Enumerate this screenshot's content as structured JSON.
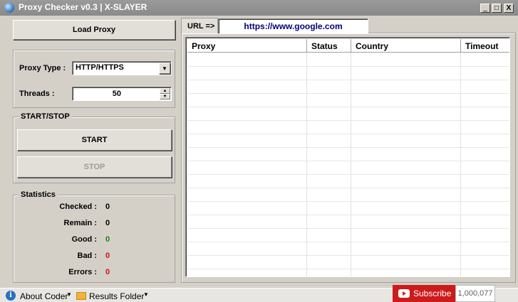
{
  "window": {
    "title": "Proxy Checker v0.3 | X-SLAYER",
    "controls": [
      "_",
      "□",
      "X"
    ]
  },
  "actions": {
    "load_proxy": "Load Proxy"
  },
  "settings": {
    "proxy_type_label": "Proxy Type :",
    "proxy_type_value": "HTTP/HTTPS",
    "threads_label": "Threads :",
    "threads_value": "50"
  },
  "control_group": {
    "title": "START/STOP",
    "start": "START",
    "stop": "STOP"
  },
  "statistics": {
    "title": "Statistics",
    "rows": [
      {
        "label": "Checked :",
        "value": "0",
        "color": "#000000"
      },
      {
        "label": "Remain :",
        "value": "0",
        "color": "#000000"
      },
      {
        "label": "Good :",
        "value": "0",
        "color": "#1a7f1a"
      },
      {
        "label": "Bad :",
        "value": "0",
        "color": "#d01010"
      },
      {
        "label": "Errors :",
        "value": "0",
        "color": "#d01010"
      }
    ]
  },
  "url": {
    "tab_label": "URL =>",
    "value": "https://www.google.com"
  },
  "table": {
    "columns": [
      "Proxy",
      "Status",
      "Country",
      "Timeout"
    ],
    "rows": []
  },
  "statusbar": {
    "about": "About Coder",
    "results": "Results Folder",
    "subscribe": "Subscribe",
    "subscriber_count": "1,000,077"
  },
  "colors": {
    "url_text": "#00007a",
    "subscribe_red": "#cc1b1b"
  }
}
